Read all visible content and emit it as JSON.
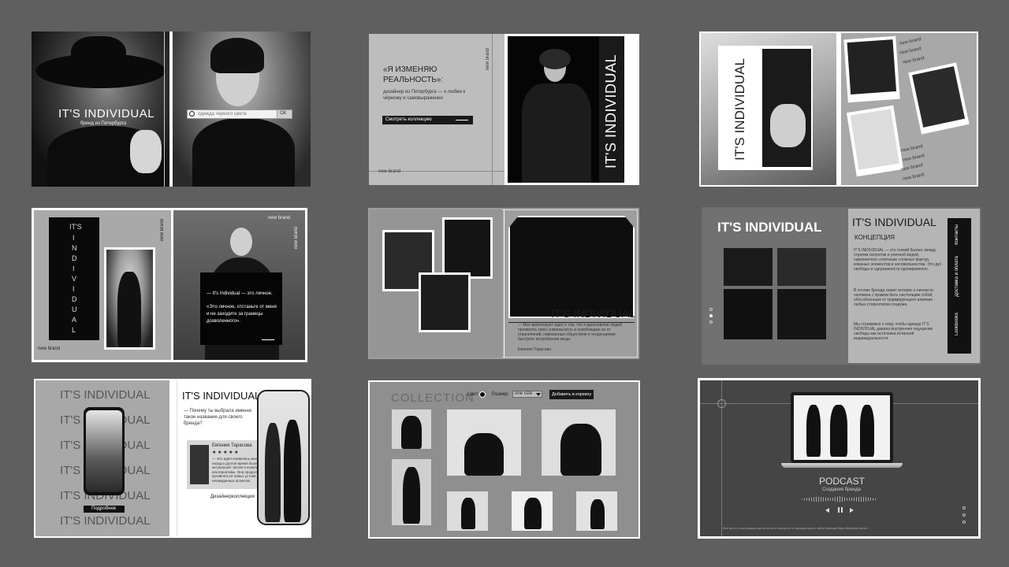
{
  "s1": {
    "brand": "IT'S INDIVIDUAL",
    "sub": "бренд из Петербурга",
    "search_placeholder": "одежда черного цвета",
    "search_btn": "ОК"
  },
  "s2": {
    "quote": "«Я ИЗМЕНЯЮ РЕАЛЬНОСТЬ»:",
    "desc": "дизайнер из Петербурга — о любви к чёрному и самовыражении",
    "btn": "Смотреть коллекцию",
    "tag": "new brand",
    "tag2": "new brand",
    "vertical": "IT'S INDIVIDUAL"
  },
  "s3": {
    "vertical": "IT'S INDIVIDUAL",
    "tags": [
      "new brand",
      "new brand",
      "new brand",
      "new brand",
      "new brand",
      "new brand",
      "new brand"
    ]
  },
  "s4": {
    "vertical": [
      "IT'S",
      "I",
      "N",
      "D",
      "I",
      "V",
      "I",
      "D",
      "U",
      "A",
      "L"
    ],
    "tag1": "new brand",
    "tag2": "new brand",
    "tag3": "new brand",
    "tag4": "new brand",
    "quote1": "— It's Individual — это личное.",
    "quote2": "«Это личное, отстаньте от меня и не заходите за границы дозволенного»."
  },
  "s5": {
    "title": "IT'S INDIVIDUAL",
    "text": "— Мне импонирует идея о том, что я вдохновляю людей проявлять свою уникальность и освобождаю их от ограничений, навязанных обществом и тенденциями быстрого потребления моды",
    "author": "Евгения Тарасова"
  },
  "s6": {
    "title": "IT'S INDIVIDUAL",
    "title2": "IT'S INDIVIDUAL",
    "concept": "КОНЦЕПЦИЯ",
    "p1": "IT'S INDIVIDUAL — это тонкий баланс между строгим силуэтом и уличной модой, гармоничное сочетание сложных фактур, кожаных элементов и несовершенства. Это дух свободы и сдержанности одновременно.",
    "p2": "В основе бренда лежит интерес к личности человека с правом быть настоящим собой, обособленным от травмирующего влияния любых стереотипов социума.",
    "p3": "Мы стремимся к тому, чтобы одежда IT'S INDIVIDUAL давала внутреннее ощущение свободы как источника истинной индивидуальности",
    "nav": [
      "Контакты",
      "Доставка и оплата",
      "Lookbooks"
    ]
  },
  "s7": {
    "repeat": [
      "IT'S INDIVIDUAL",
      "IT'S INDIVIDUAL",
      "IT'S INDIVIDUAL",
      "IT'S INDIVIDUAL",
      "IT'S INDIVIDUAL",
      "IT'S INDIVIDUAL"
    ],
    "btn": "Подробнее",
    "title": "IT'S INDIVIDUAL",
    "q": "— Почему ты выбрала именно такое название для своего бренда?",
    "name": "Евгения Тарасова",
    "stars": "★ ★ ★ ★ ★",
    "review": "— Это идея появилась много лет назад и долгое время была актуальной. Затем я искала альтернативы. Она продолжает проявляться новых устоев и в неожиданных аспектах.",
    "link": "Дизайнерколлекции"
  },
  "s8": {
    "title": "COLLECTION",
    "color_label": "Цвет",
    "size_label": "Размер",
    "size_value": "one size",
    "cart_btn": "Добавить в корзину"
  },
  "s9": {
    "title": "PODCAST",
    "sub": "Создание бренда",
    "footer": "Все фото и персонажи взяты из сети интернет и официального  сайта бренда https://itsindividual.ru/"
  }
}
